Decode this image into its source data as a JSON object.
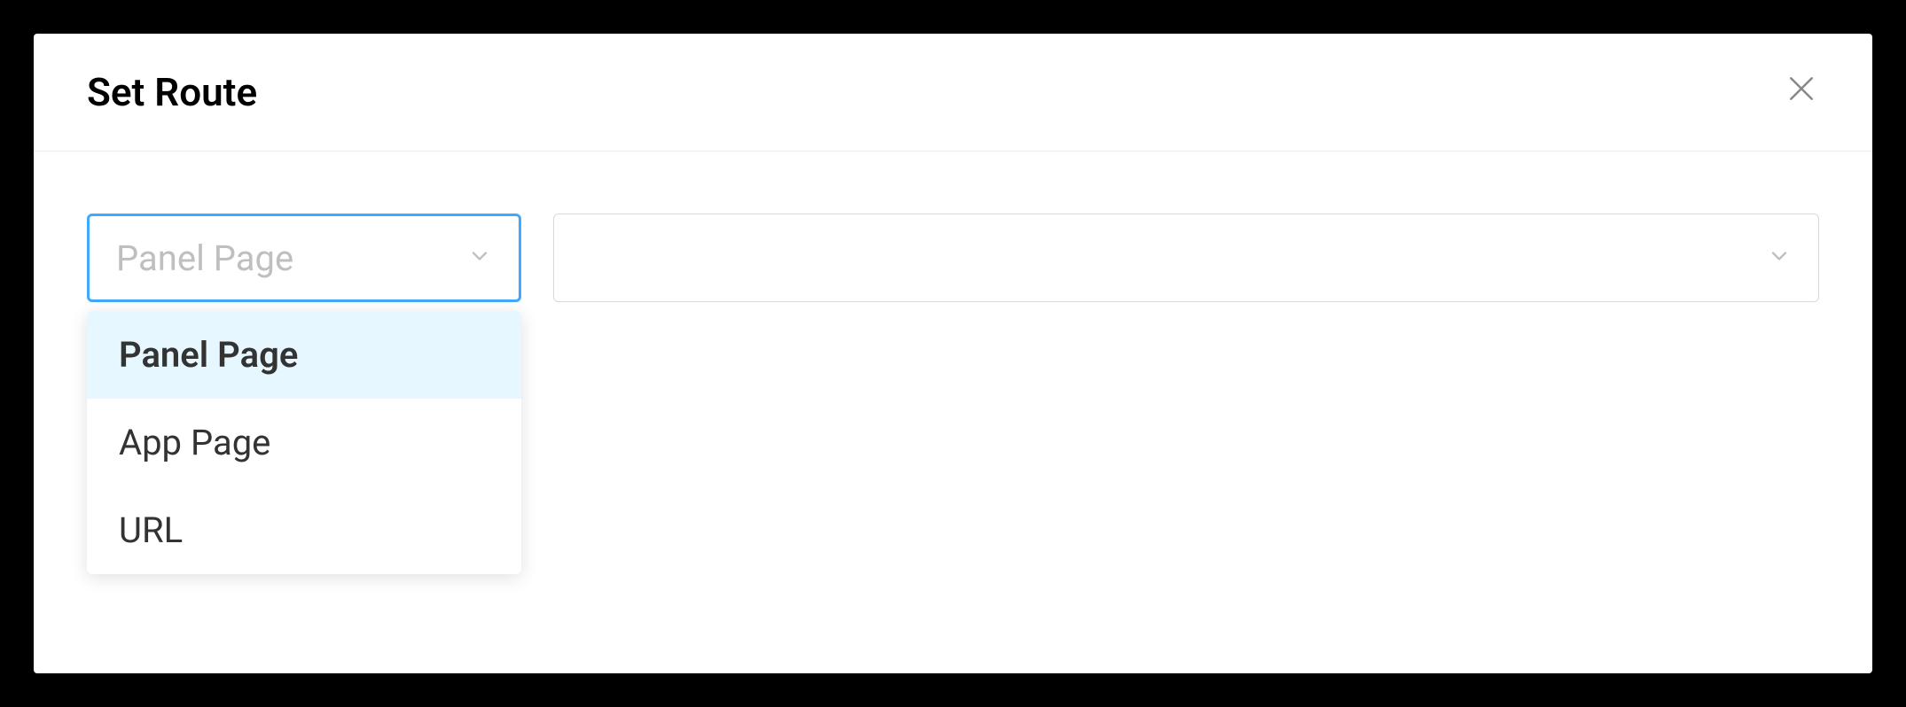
{
  "dialog": {
    "title": "Set Route"
  },
  "routeTypeSelect": {
    "placeholder": "Panel Page",
    "options": [
      {
        "label": "Panel Page"
      },
      {
        "label": "App Page"
      },
      {
        "label": "URL"
      }
    ]
  },
  "routeTargetSelect": {
    "value": ""
  }
}
